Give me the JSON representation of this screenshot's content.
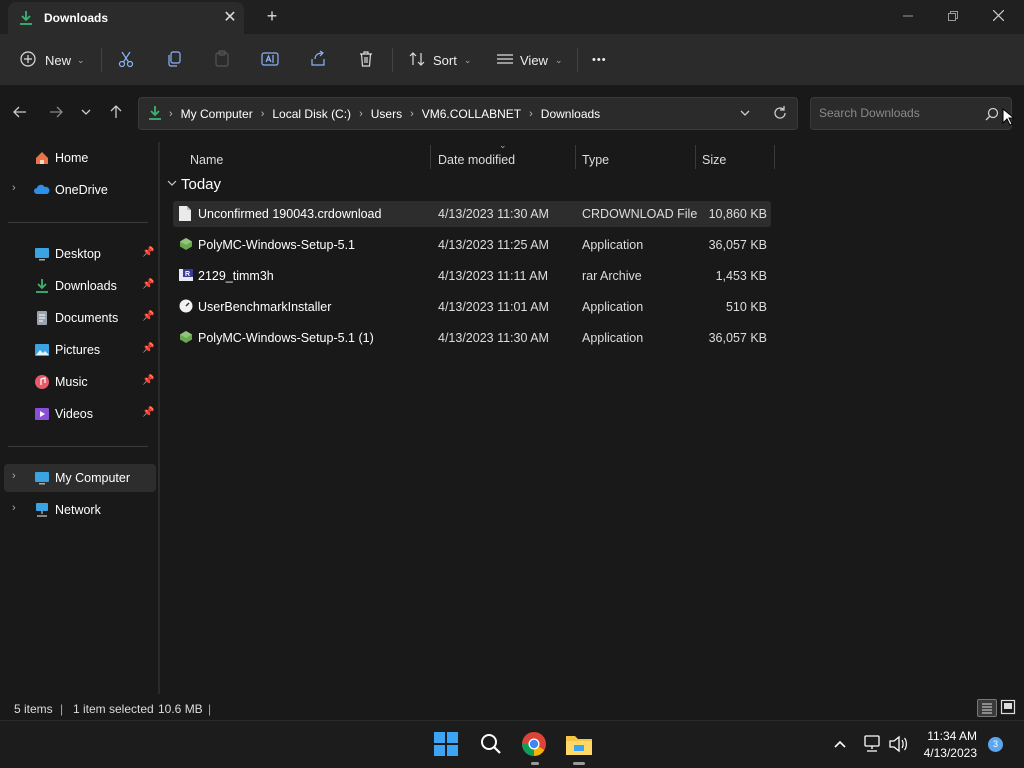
{
  "window": {
    "tab_title": "Downloads",
    "tab_close": "✕",
    "new_tab": "+"
  },
  "toolbar": {
    "new_label": "New",
    "sort_label": "Sort",
    "view_label": "View",
    "more_label": "•••"
  },
  "address": {
    "crumbs": [
      "My Computer",
      "Local Disk (C:)",
      "Users",
      "VM6.COLLABNET",
      "Downloads"
    ],
    "search_placeholder": "Search Downloads"
  },
  "sidebar": {
    "items": [
      {
        "label": "Home"
      },
      {
        "label": "OneDrive"
      },
      {
        "label": "Desktop"
      },
      {
        "label": "Downloads"
      },
      {
        "label": "Documents"
      },
      {
        "label": "Pictures"
      },
      {
        "label": "Music"
      },
      {
        "label": "Videos"
      },
      {
        "label": "My Computer"
      },
      {
        "label": "Network"
      }
    ]
  },
  "columns": {
    "name": "Name",
    "date": "Date modified",
    "type": "Type",
    "size": "Size"
  },
  "group_label": "Today",
  "files": [
    {
      "name": "Unconfirmed 190043.crdownload",
      "date": "4/13/2023 11:30 AM",
      "type": "CRDOWNLOAD File",
      "size": "10,860 KB",
      "icon": "file-icon"
    },
    {
      "name": "PolyMC-Windows-Setup-5.1",
      "date": "4/13/2023 11:25 AM",
      "type": "Application",
      "size": "36,057 KB",
      "icon": "polymc-icon"
    },
    {
      "name": "2129_timm3h",
      "date": "4/13/2023 11:11 AM",
      "type": "rar Archive",
      "size": "1,453 KB",
      "icon": "rar-icon"
    },
    {
      "name": "UserBenchmarkInstaller",
      "date": "4/13/2023 11:01 AM",
      "type": "Application",
      "size": "510 KB",
      "icon": "benchmark-icon"
    },
    {
      "name": "PolyMC-Windows-Setup-5.1 (1)",
      "date": "4/13/2023 11:30 AM",
      "type": "Application",
      "size": "36,057 KB",
      "icon": "polymc-icon"
    }
  ],
  "status": {
    "count": "5 items",
    "selection": "1 item selected",
    "selection_size": "10.6 MB"
  },
  "taskbar": {
    "time": "11:34 AM",
    "date": "4/13/2023",
    "notification_count": "3"
  },
  "colors": {
    "accent": "#0078d4",
    "download_green": "#3cb371",
    "folder_yellow": "#f4c542"
  }
}
